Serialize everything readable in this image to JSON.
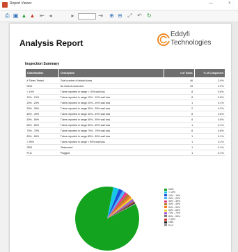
{
  "window": {
    "title": "Report Viewer",
    "min": "—",
    "close": "×"
  },
  "toolbar": {
    "icons": [
      "print-icon",
      "save-icon",
      "export-icon",
      "pdf-icon",
      "first-page-icon",
      "prev-page-icon",
      "next-page-icon",
      "last-page-icon",
      "zoom-in-icon",
      "zoom-out-icon",
      "fit-icon",
      "back-icon",
      "refresh-icon"
    ],
    "colors": {
      "accent_blue": "#2f6fb7",
      "accent_red": "#c73a2a",
      "accent_green": "#2e9c47"
    }
  },
  "report": {
    "title": "Analysis Report",
    "logo_line1": "Eddyfi",
    "logo_line2": "Technologies",
    "logo_color": "#f08a24",
    "section_title": "Inspection Summary",
    "table": {
      "headers": [
        "Classification",
        "Description",
        "# of Tubes",
        "% of Component"
      ],
      "rows": [
        [
          "# Tubes Tested",
          "Total number of tested tubes",
          "46",
          "3.9%"
        ],
        [
          "NDD",
          "No Defects Detected",
          "33",
          "2.9%"
        ],
        [
          "< 10%",
          "Tubes reported in range < 10% wall loss",
          "8",
          "0.6%"
        ],
        [
          "10% - 19%",
          "Tubes reported in range 10% - 19% wall loss",
          "8",
          "0.6%"
        ],
        [
          "20% - 29%",
          "Tubes reported in range 20% - 29% wall loss",
          "1",
          "0.1%"
        ],
        [
          "30% - 39%",
          "Tubes reported in range 30% - 39% wall loss",
          "2",
          "0.2%"
        ],
        [
          "40% - 49%",
          "Tubes reported in range 40% - 49% wall loss",
          "8",
          "0.6%"
        ],
        [
          "50% - 59%",
          "Tubes reported in range 50% - 59% wall loss",
          "8",
          "0.6%"
        ],
        [
          "60% - 69%",
          "Tubes reported in range 60% - 69% wall loss",
          "1",
          "0.1%"
        ],
        [
          "70% - 79%",
          "Tubes reported in range 70% - 79% wall loss",
          "8",
          "0.6%"
        ],
        [
          "80% - 89%",
          "Tubes reported in range 80% - 89% wall loss",
          "1",
          "0.1%"
        ],
        [
          "> 90%",
          "Tubes reported in range > 90% wall loss",
          "1",
          "0.1%"
        ],
        [
          "OBS",
          "Obstructed",
          "1",
          "0.1%"
        ],
        [
          "PLG",
          "Plugged",
          "1",
          "0.1%"
        ]
      ]
    }
  },
  "chart_data": {
    "type": "pie",
    "title": "",
    "series": [
      {
        "name": "NDD",
        "value": 86,
        "color": "#14a31e"
      },
      {
        "name": "< 10%",
        "value": 3,
        "color": "#18c6e8"
      },
      {
        "name": "10% - 19%",
        "value": 2,
        "color": "#1d4ed8"
      },
      {
        "name": "20% - 29%",
        "value": 1.5,
        "color": "#4bb3ff"
      },
      {
        "name": "30% - 39%",
        "value": 1.5,
        "color": "#e53c87"
      },
      {
        "name": "40% - 49%",
        "value": 1.5,
        "color": "#b47a2e"
      },
      {
        "name": "50% - 59%",
        "value": 1,
        "color": "#ff7a20"
      },
      {
        "name": "60% - 69%",
        "value": 1,
        "color": "#e9d62f"
      },
      {
        "name": "70% - 79%",
        "value": 1,
        "color": "#a854d6"
      },
      {
        "name": "80% - 89%",
        "value": 0.5,
        "color": "#7a7a7a"
      },
      {
        "name": "> 90%",
        "value": 0.5,
        "color": "#d1352c"
      },
      {
        "name": "OBS",
        "value": 0.5,
        "color": "#222222"
      },
      {
        "name": "PLG",
        "value": 0.5,
        "color": "#9b9b9b"
      }
    ]
  }
}
